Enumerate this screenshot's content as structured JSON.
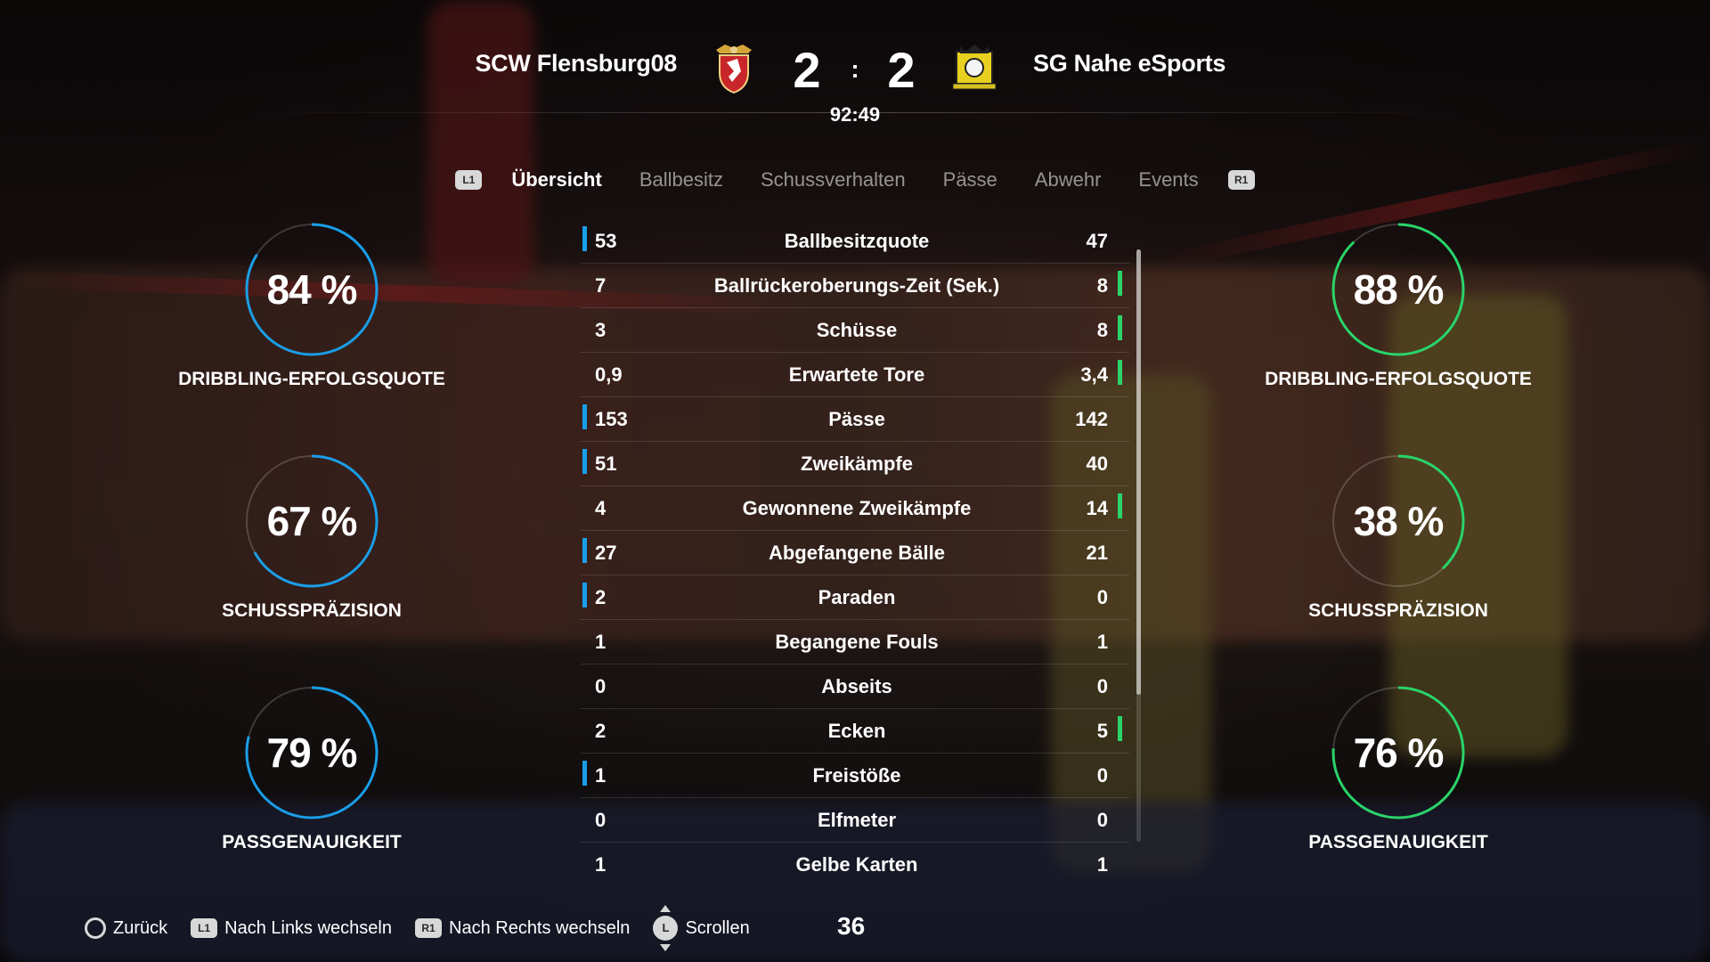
{
  "header": {
    "home_team": "SCW Flensburg08",
    "away_team": "SG Nahe eSports",
    "home_score": "2",
    "away_score": "2",
    "separator": ":",
    "clock": "92:49"
  },
  "tabs": {
    "left_button": "L1",
    "right_button": "R1",
    "items": [
      "Übersicht",
      "Ballbesitz",
      "Schussverhalten",
      "Pässe",
      "Abwehr",
      "Events"
    ],
    "active": "Übersicht"
  },
  "home_rings": [
    {
      "value": "84 %",
      "percent": 84,
      "label": "DRIBBLING-ERFOLGSQUOTE"
    },
    {
      "value": "67 %",
      "percent": 67,
      "label": "SCHUSSPRÄZISION"
    },
    {
      "value": "79 %",
      "percent": 79,
      "label": "PASSGENAUIGKEIT"
    }
  ],
  "away_rings": [
    {
      "value": "88 %",
      "percent": 88,
      "label": "DRIBBLING-ERFOLGSQUOTE"
    },
    {
      "value": "38 %",
      "percent": 38,
      "label": "SCHUSSPRÄZISION"
    },
    {
      "value": "76 %",
      "percent": 76,
      "label": "PASSGENAUIGKEIT"
    }
  ],
  "colors": {
    "home": "#1a9ee8",
    "away": "#2ad46a"
  },
  "stats": [
    {
      "name": "Ballbesitzquote",
      "home": "53",
      "away": "47",
      "leader": "home"
    },
    {
      "name": "Ballrückeroberungs-Zeit (Sek.)",
      "home": "7",
      "away": "8",
      "leader": "away"
    },
    {
      "name": "Schüsse",
      "home": "3",
      "away": "8",
      "leader": "away"
    },
    {
      "name": "Erwartete Tore",
      "home": "0,9",
      "away": "3,4",
      "leader": "away"
    },
    {
      "name": "Pässe",
      "home": "153",
      "away": "142",
      "leader": "home"
    },
    {
      "name": "Zweikämpfe",
      "home": "51",
      "away": "40",
      "leader": "home"
    },
    {
      "name": "Gewonnene Zweikämpfe",
      "home": "4",
      "away": "14",
      "leader": "away"
    },
    {
      "name": "Abgefangene Bälle",
      "home": "27",
      "away": "21",
      "leader": "home"
    },
    {
      "name": "Paraden",
      "home": "2",
      "away": "0",
      "leader": "home"
    },
    {
      "name": "Begangene Fouls",
      "home": "1",
      "away": "1",
      "leader": "none"
    },
    {
      "name": "Abseits",
      "home": "0",
      "away": "0",
      "leader": "none"
    },
    {
      "name": "Ecken",
      "home": "2",
      "away": "5",
      "leader": "away"
    },
    {
      "name": "Freistöße",
      "home": "1",
      "away": "0",
      "leader": "home"
    },
    {
      "name": "Elfmeter",
      "home": "0",
      "away": "0",
      "leader": "none"
    },
    {
      "name": "Gelbe Karten",
      "home": "1",
      "away": "1",
      "leader": "none"
    }
  ],
  "footer": {
    "back": "Zurück",
    "left_button": "L1",
    "switch_left": "Nach Links wechseln",
    "right_button": "R1",
    "switch_right": "Nach Rechts wechseln",
    "stick": "L",
    "scroll": "Scrollen",
    "page_number": "36"
  }
}
